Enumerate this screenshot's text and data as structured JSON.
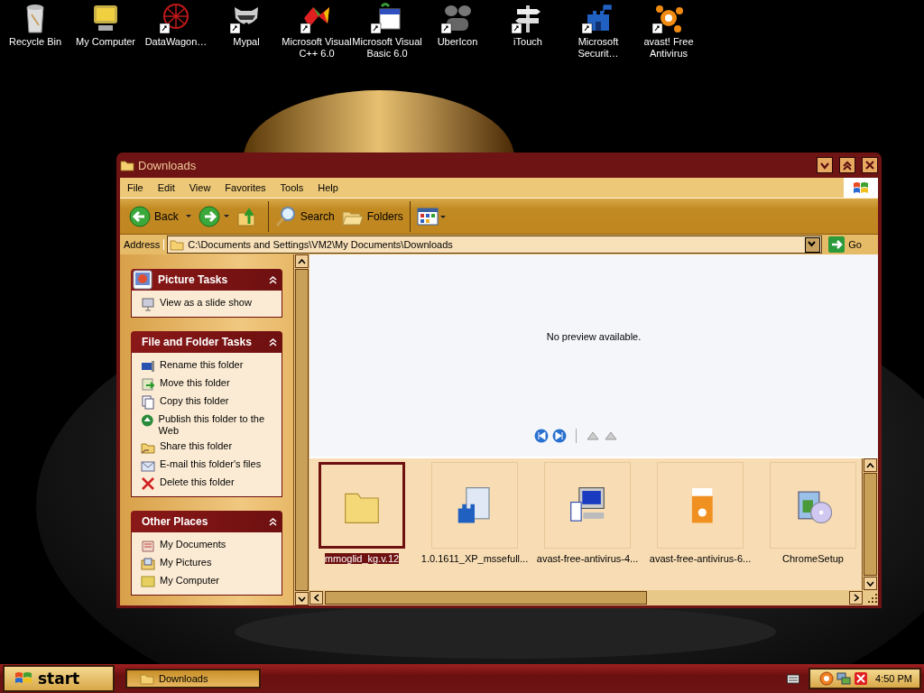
{
  "desktop_icons": [
    {
      "label": "Recycle Bin",
      "shortcut": false
    },
    {
      "label": "My Computer",
      "shortcut": false
    },
    {
      "label": "DataWagon…",
      "shortcut": true
    },
    {
      "label": "Mypal",
      "shortcut": true
    },
    {
      "label": "Microsoft Visual C++ 6.0",
      "shortcut": true
    },
    {
      "label": "Microsoft Visual Basic 6.0",
      "shortcut": true
    },
    {
      "label": "UberIcon",
      "shortcut": true
    },
    {
      "label": "iTouch",
      "shortcut": true
    },
    {
      "label": "Microsoft Securit…",
      "shortcut": true
    },
    {
      "label": "avast! Free Antivirus",
      "shortcut": true
    }
  ],
  "window": {
    "title": "Downloads",
    "menu": [
      "File",
      "Edit",
      "View",
      "Favorites",
      "Tools",
      "Help"
    ],
    "toolbar": {
      "back": "Back",
      "search": "Search",
      "folders": "Folders"
    },
    "address": {
      "label": "Address",
      "path": "C:\\Documents and Settings\\VM2\\My Documents\\Downloads",
      "go": "Go"
    },
    "panels": [
      {
        "title": "Picture Tasks",
        "items": [
          "View as a slide show"
        ]
      },
      {
        "title": "File and Folder Tasks",
        "items": [
          "Rename this folder",
          "Move this folder",
          "Copy this folder",
          "Publish this folder to the Web",
          "Share this folder",
          "E-mail this folder's files",
          "Delete this folder"
        ]
      },
      {
        "title": "Other Places",
        "items": [
          "My Documents",
          "My Pictures",
          "My Computer"
        ]
      }
    ],
    "preview": {
      "message": "No preview available."
    },
    "files": [
      {
        "name": "mmoglid_kg.v.12",
        "selected": true
      },
      {
        "name": "1.0.1611_XP_mssefull...",
        "selected": false
      },
      {
        "name": "avast-free-antivirus-4...",
        "selected": false
      },
      {
        "name": "avast-free-antivirus-6...",
        "selected": false
      },
      {
        "name": "ChromeSetup",
        "selected": false
      }
    ]
  },
  "taskbar": {
    "start": "start",
    "tasks": [
      {
        "label": "Downloads",
        "selected": true
      }
    ],
    "clock": "4:50 PM"
  }
}
